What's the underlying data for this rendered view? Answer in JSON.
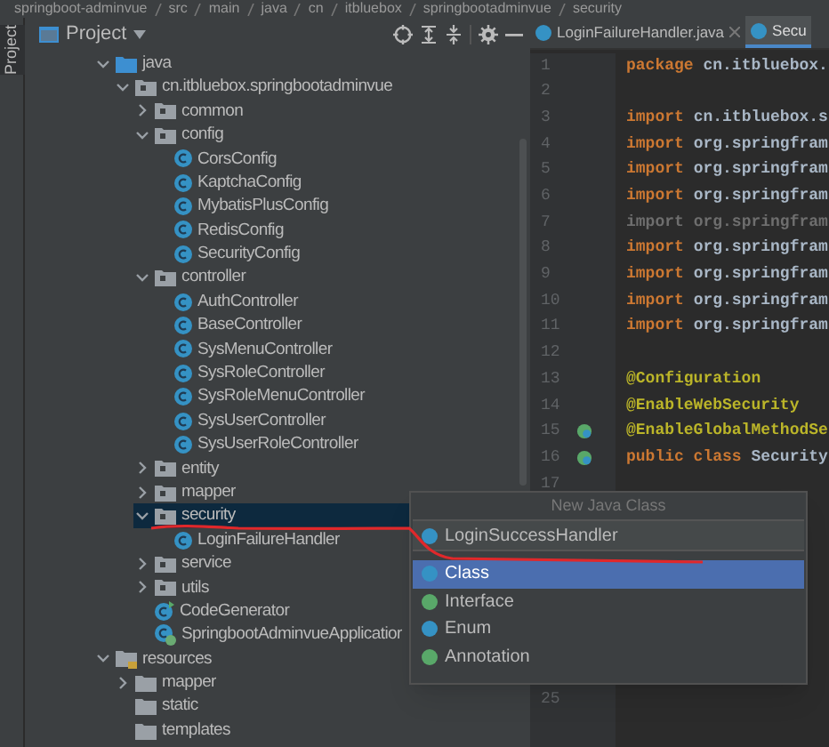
{
  "breadcrumb": [
    "springboot-adminvue",
    "src",
    "main",
    "java",
    "cn",
    "itbluebox",
    "springbootadminvue",
    "security"
  ],
  "side_tab": "Project",
  "project_panel": {
    "title": "Project",
    "tree": [
      {
        "label": "java",
        "kind": "source",
        "expanded": true,
        "selected": false,
        "children": [
          {
            "label": "cn.itbluebox.springbootadminvue",
            "kind": "package",
            "expanded": true,
            "selected": false,
            "children": [
              {
                "label": "common",
                "kind": "package",
                "expanded": false,
                "selected": false
              },
              {
                "label": "config",
                "kind": "package",
                "expanded": true,
                "selected": false,
                "children": [
                  {
                    "label": "CorsConfig",
                    "kind": "class",
                    "selected": false
                  },
                  {
                    "label": "KaptchaConfig",
                    "kind": "class",
                    "selected": false
                  },
                  {
                    "label": "MybatisPlusConfig",
                    "kind": "class",
                    "selected": false
                  },
                  {
                    "label": "RedisConfig",
                    "kind": "class",
                    "selected": false
                  },
                  {
                    "label": "SecurityConfig",
                    "kind": "class",
                    "selected": false
                  }
                ]
              },
              {
                "label": "controller",
                "kind": "package",
                "expanded": true,
                "selected": false,
                "children": [
                  {
                    "label": "AuthController",
                    "kind": "class",
                    "selected": false
                  },
                  {
                    "label": "BaseController",
                    "kind": "class",
                    "selected": false
                  },
                  {
                    "label": "SysMenuController",
                    "kind": "class",
                    "selected": false
                  },
                  {
                    "label": "SysRoleController",
                    "kind": "class",
                    "selected": false
                  },
                  {
                    "label": "SysRoleMenuController",
                    "kind": "class",
                    "selected": false
                  },
                  {
                    "label": "SysUserController",
                    "kind": "class",
                    "selected": false
                  },
                  {
                    "label": "SysUserRoleController",
                    "kind": "class",
                    "selected": false
                  }
                ]
              },
              {
                "label": "entity",
                "kind": "package",
                "expanded": false,
                "selected": false
              },
              {
                "label": "mapper",
                "kind": "package",
                "expanded": false,
                "selected": false
              },
              {
                "label": "security",
                "kind": "package",
                "expanded": true,
                "selected": true,
                "children": [
                  {
                    "label": "LoginFailureHandler",
                    "kind": "class",
                    "selected": false
                  }
                ]
              },
              {
                "label": "service",
                "kind": "package",
                "expanded": false,
                "selected": false
              },
              {
                "label": "utils",
                "kind": "package",
                "expanded": false,
                "selected": false
              },
              {
                "label": "CodeGenerator",
                "kind": "runnable",
                "selected": false
              },
              {
                "label": "SpringbootAdminvueApplicatior",
                "kind": "app",
                "selected": false
              }
            ]
          }
        ]
      },
      {
        "label": "resources",
        "kind": "resources",
        "expanded": true,
        "selected": false,
        "children": [
          {
            "label": "mapper",
            "kind": "folder",
            "expanded": false,
            "selected": false
          },
          {
            "label": "static",
            "kind": "folder",
            "selected": false
          },
          {
            "label": "templates",
            "kind": "folder",
            "selected": false
          }
        ]
      }
    ]
  },
  "editor_tabs": [
    {
      "label": "LoginFailureHandler.java",
      "selected": false,
      "closable": true
    },
    {
      "label": "Secu",
      "selected": true,
      "closable": false
    }
  ],
  "code_lines": [
    {
      "number": "1",
      "parts": [
        {
          "text": "package ",
          "kind": "keyword"
        },
        {
          "text": "cn.itbluebox.",
          "kind": "plain"
        }
      ]
    },
    {
      "number": "2"
    },
    {
      "number": "3",
      "parts": [
        {
          "text": "import ",
          "kind": "keyword"
        },
        {
          "text": "cn.itbluebox.s",
          "kind": "plain"
        }
      ]
    },
    {
      "number": "4",
      "parts": [
        {
          "text": "import ",
          "kind": "keyword"
        },
        {
          "text": "org.springfram",
          "kind": "plain"
        }
      ]
    },
    {
      "number": "5",
      "parts": [
        {
          "text": "import ",
          "kind": "keyword"
        },
        {
          "text": "org.springfram",
          "kind": "plain"
        }
      ]
    },
    {
      "number": "6",
      "parts": [
        {
          "text": "import ",
          "kind": "keyword"
        },
        {
          "text": "org.springfram",
          "kind": "plain"
        }
      ]
    },
    {
      "number": "7",
      "parts": [
        {
          "text": "import ",
          "kind": "unused"
        },
        {
          "text": "org.springfram",
          "kind": "unused"
        }
      ]
    },
    {
      "number": "8",
      "parts": [
        {
          "text": "import ",
          "kind": "keyword"
        },
        {
          "text": "org.springfram",
          "kind": "plain"
        }
      ]
    },
    {
      "number": "9",
      "parts": [
        {
          "text": "import ",
          "kind": "keyword"
        },
        {
          "text": "org.springfram",
          "kind": "plain"
        }
      ]
    },
    {
      "number": "10",
      "parts": [
        {
          "text": "import ",
          "kind": "keyword"
        },
        {
          "text": "org.springfram",
          "kind": "plain"
        }
      ]
    },
    {
      "number": "11",
      "parts": [
        {
          "text": "import ",
          "kind": "keyword"
        },
        {
          "text": "org.springfram",
          "kind": "plain"
        }
      ]
    },
    {
      "number": "12"
    },
    {
      "number": "13",
      "parts": [
        {
          "text": "@Configuration",
          "kind": "annotation"
        }
      ]
    },
    {
      "number": "14",
      "parts": [
        {
          "text": "@EnableWebSecurity",
          "kind": "annotation"
        }
      ]
    },
    {
      "number": "15",
      "gutter_icon": true,
      "parts": [
        {
          "text": "@EnableGlobalMethodSe",
          "kind": "annotation"
        }
      ]
    },
    {
      "number": "16",
      "gutter_icon": true,
      "parts": [
        {
          "text": "public class ",
          "kind": "keyword"
        },
        {
          "text": "Security",
          "kind": "plain"
        }
      ]
    },
    {
      "number": "17"
    }
  ],
  "popup": {
    "title": "New Java Class",
    "value": "LoginSuccessHandler",
    "options": [
      {
        "label": "Class",
        "kind": "class",
        "selected": true
      },
      {
        "label": "Interface",
        "kind": "interface",
        "selected": false
      },
      {
        "label": "Enum",
        "kind": "enum",
        "selected": false
      },
      {
        "label": "Annotation",
        "kind": "annotation",
        "selected": false
      }
    ]
  },
  "bottom_line_number": "25"
}
